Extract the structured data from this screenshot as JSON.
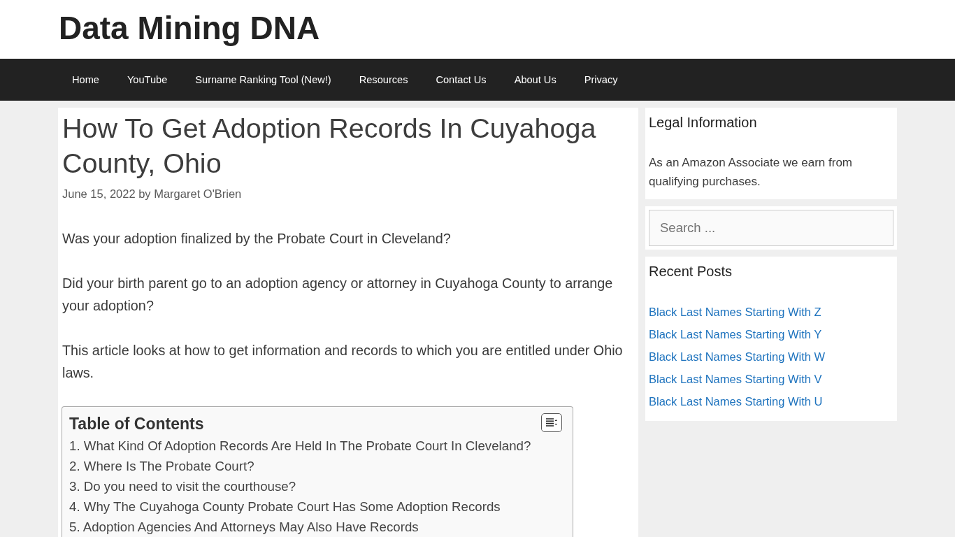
{
  "site": {
    "title": "Data Mining DNA"
  },
  "nav": {
    "items": [
      "Home",
      "YouTube",
      "Surname Ranking Tool (New!)",
      "Resources",
      "Contact Us",
      "About Us",
      "Privacy"
    ]
  },
  "article": {
    "title": "How To Get Adoption Records In Cuyahoga County, Ohio",
    "meta": "June 15, 2022 by Margaret O'Brien",
    "paragraphs": [
      "Was your adoption finalized by the Probate Court in Cleveland?",
      "Did your birth parent go to an adoption agency or attorney in Cuyahoga County to arrange your adoption?",
      "This article looks at how to get information and records to which you are entitled under Ohio laws."
    ],
    "toc": {
      "title": "Table of Contents",
      "items": [
        "1. What Kind Of Adoption Records Are Held In The Probate Court In Cleveland?",
        "2. Where Is The Probate Court?",
        "3. Do you need to visit the courthouse?",
        "4. Why The Cuyahoga County Probate Court Has Some Adoption Records",
        "5. Adoption Agencies And Attorneys May Also Have Records"
      ]
    }
  },
  "sidebar": {
    "widgets": [
      {
        "kind": "text",
        "heading": "Legal Information",
        "text": "As an Amazon Associate we earn from qualifying purchases."
      },
      {
        "kind": "search",
        "placeholder": "Search ..."
      },
      {
        "kind": "links",
        "heading": "Recent Posts",
        "links": [
          "Black Last Names Starting With Z",
          "Black Last Names Starting With Y",
          "Black Last Names Starting With W",
          "Black Last Names Starting With V",
          "Black Last Names Starting With U"
        ]
      }
    ]
  }
}
